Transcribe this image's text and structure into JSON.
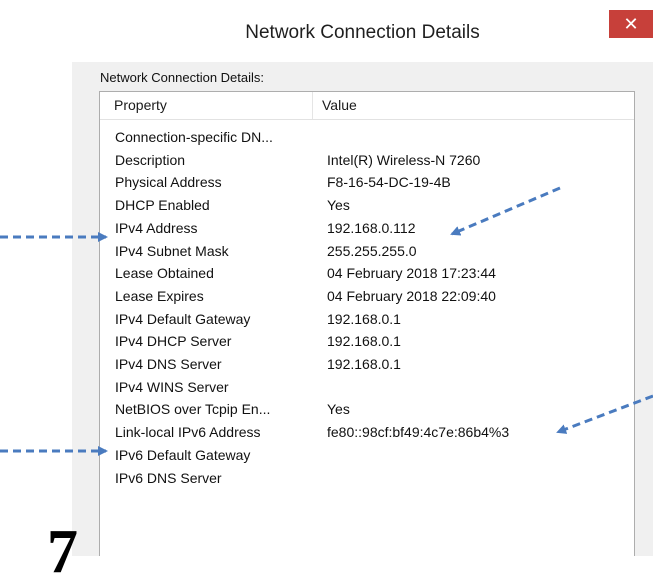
{
  "window": {
    "title": "Network Connection Details",
    "close_glyph": "✕"
  },
  "group_label": "Network Connection Details:",
  "columns": {
    "property": "Property",
    "value": "Value"
  },
  "rows": [
    {
      "property": "Connection-specific DN...",
      "value": ""
    },
    {
      "property": "Description",
      "value": "Intel(R) Wireless-N 7260"
    },
    {
      "property": "Physical Address",
      "value": "F8-16-54-DC-19-4B"
    },
    {
      "property": "DHCP Enabled",
      "value": "Yes"
    },
    {
      "property": "IPv4 Address",
      "value": "192.168.0.112"
    },
    {
      "property": "IPv4 Subnet Mask",
      "value": "255.255.255.0"
    },
    {
      "property": "Lease Obtained",
      "value": "04 February 2018 17:23:44"
    },
    {
      "property": "Lease Expires",
      "value": "04 February 2018 22:09:40"
    },
    {
      "property": "IPv4 Default Gateway",
      "value": "192.168.0.1"
    },
    {
      "property": "IPv4 DHCP Server",
      "value": "192.168.0.1"
    },
    {
      "property": "IPv4 DNS Server",
      "value": "192.168.0.1"
    },
    {
      "property": "IPv4 WINS Server",
      "value": ""
    },
    {
      "property": "NetBIOS over Tcpip En...",
      "value": "Yes"
    },
    {
      "property": "Link-local IPv6 Address",
      "value": "fe80::98cf:bf49:4c7e:86b4%3"
    },
    {
      "property": "IPv6 Default Gateway",
      "value": ""
    },
    {
      "property": "IPv6 DNS Server",
      "value": ""
    }
  ],
  "overlay": {
    "big_char": "7",
    "arrow_color": "#4a7bbf"
  }
}
